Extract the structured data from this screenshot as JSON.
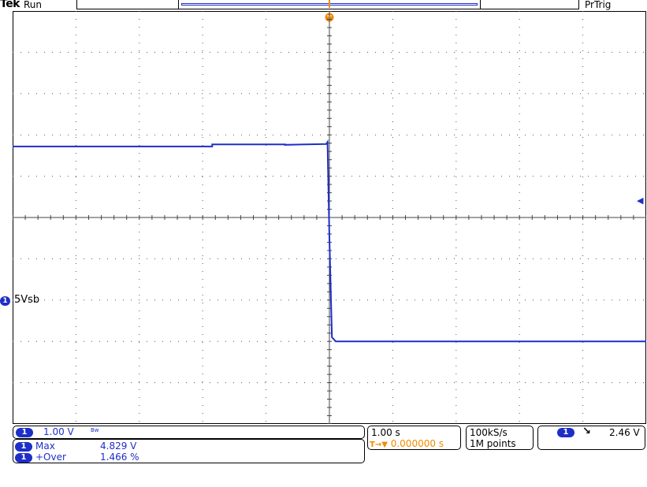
{
  "header": {
    "brand": "Tek",
    "run_state": "Run",
    "trigger_status": "PrTrig"
  },
  "trigger_marker": "T",
  "channel": {
    "number": "1",
    "label": "5Vsb",
    "color": "#1e2ec8",
    "volts_per_div": "1.00 V",
    "bandwidth_marker": "Bᴡ"
  },
  "measurements": [
    {
      "ch": "1",
      "name": "Max",
      "value": "4.829 V"
    },
    {
      "ch": "1",
      "name": "+Over",
      "value": "1.466 %"
    }
  ],
  "timebase": {
    "time_per_div": "1.00 s",
    "trigger_position": "0.000000 s",
    "trigger_position_prefix": "T→▼"
  },
  "acquisition": {
    "sample_rate": "100kS/s",
    "record_length": "1M points"
  },
  "trigger": {
    "source": "1",
    "slope_symbol": "↘",
    "level": "2.46 V"
  },
  "colors": {
    "trace": "#1e2ec8",
    "trigger": "#f08c00",
    "grid": "#000000",
    "background": "#ffffff"
  },
  "chart_data": {
    "type": "line",
    "title": "",
    "xlabel": "",
    "ylabel": "",
    "x_unit": "s",
    "y_unit": "V",
    "grid": true,
    "x_divisions": 10,
    "y_divisions": 10,
    "xlim": [
      -5,
      5
    ],
    "ylim": [
      -2,
      8
    ],
    "series": [
      {
        "x": [
          -5.0,
          -1.85,
          -1.85,
          -0.7,
          -0.7,
          -0.05,
          -0.03,
          0.0,
          0.04,
          0.1,
          5.0
        ],
        "y": [
          4.72,
          4.72,
          4.77,
          4.77,
          4.76,
          4.78,
          4.829,
          2.5,
          0.1,
          0.0,
          0.0
        ]
      }
    ]
  }
}
